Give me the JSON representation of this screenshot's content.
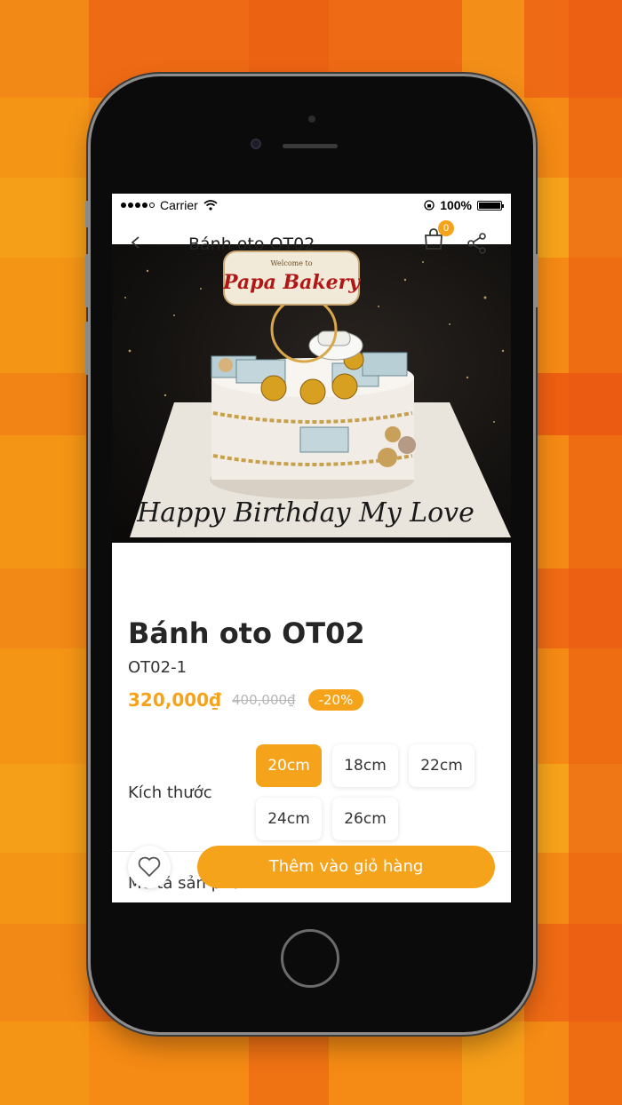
{
  "status_bar": {
    "carrier": "Carrier",
    "battery": "100%"
  },
  "nav": {
    "title": "Bánh oto OT02",
    "cart_count": "0"
  },
  "cake_image": {
    "sign_text": "Papa Bakery",
    "sign_top": "Welcome to",
    "plate_text": "Happy Birthday My Love"
  },
  "product": {
    "name": "Bánh oto OT02",
    "sku": "OT02-1",
    "price": "320,000₫",
    "old_price": "400,000₫",
    "discount": "-20%"
  },
  "size": {
    "label": "Kích thước",
    "options": [
      "20cm",
      "18cm",
      "22cm",
      "24cm",
      "26cm"
    ],
    "selected": "20cm"
  },
  "description": {
    "label": "Mô tả sản phẩm"
  },
  "actions": {
    "add_to_cart": "Thêm vào giỏ hàng"
  },
  "colors": {
    "accent": "#f5a31a",
    "background": "#f58a14"
  }
}
